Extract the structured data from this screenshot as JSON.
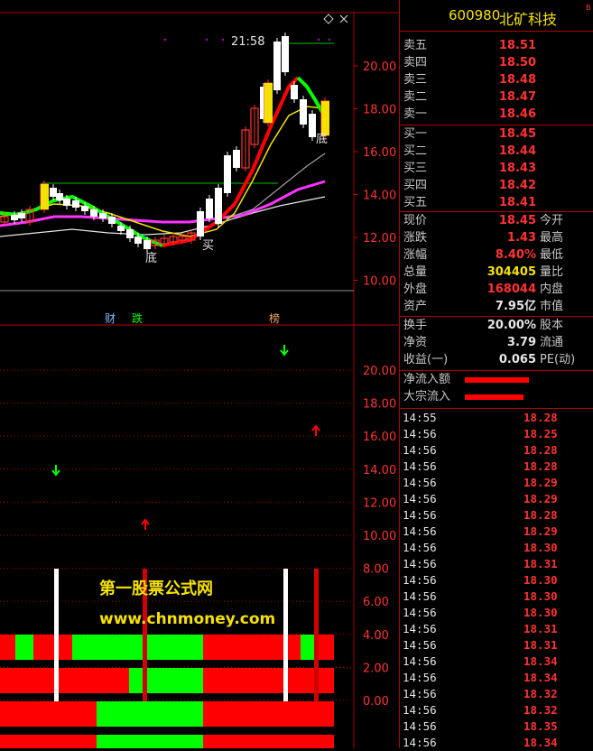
{
  "stock": {
    "code": "600980",
    "name": "北矿科技",
    "marker": "B"
  },
  "order_book": {
    "sell": [
      {
        "label": "卖五",
        "price": "18.51"
      },
      {
        "label": "卖四",
        "price": "18.50"
      },
      {
        "label": "卖三",
        "price": "18.48"
      },
      {
        "label": "卖二",
        "price": "18.47"
      },
      {
        "label": "卖一",
        "price": "18.46"
      }
    ],
    "buy": [
      {
        "label": "买一",
        "price": "18.45"
      },
      {
        "label": "买二",
        "price": "18.44"
      },
      {
        "label": "买三",
        "price": "18.43"
      },
      {
        "label": "买四",
        "price": "18.42"
      },
      {
        "label": "买五",
        "price": "18.41"
      }
    ]
  },
  "quote": [
    {
      "l1": "现价",
      "v1": "18.45",
      "l2": "今开",
      "color": "red"
    },
    {
      "l1": "涨跌",
      "v1": "1.43",
      "l2": "最高",
      "color": "red"
    },
    {
      "l1": "涨幅",
      "v1": "8.40%",
      "l2": "最低",
      "color": "red"
    },
    {
      "l1": "总量",
      "v1": "304405",
      "l2": "量比",
      "color": "yellow"
    },
    {
      "l1": "外盘",
      "v1": "168044",
      "l2": "内盘",
      "color": "red"
    },
    {
      "l1": "资产",
      "v1": "7.95亿",
      "l2": "市值",
      "color": "white"
    }
  ],
  "stats": [
    {
      "l1": "换手",
      "v1": "20.00%",
      "l2": "股本"
    },
    {
      "l1": "净资",
      "v1": "3.79",
      "l2": "流通"
    },
    {
      "l1": "收益(一)",
      "v1": "0.065",
      "l2": "PE(动)"
    }
  ],
  "flows": [
    {
      "label": "净流入额",
      "bar": 0.47
    },
    {
      "label": "大宗流入",
      "bar": 0.43
    }
  ],
  "ticks": [
    {
      "time": "14:55",
      "price": "18.28"
    },
    {
      "time": "14:56",
      "price": "18.25"
    },
    {
      "time": "14:56",
      "price": "18.28"
    },
    {
      "time": "14:56",
      "price": "18.28"
    },
    {
      "time": "14:56",
      "price": "18.29"
    },
    {
      "time": "14:56",
      "price": "18.29"
    },
    {
      "time": "14:56",
      "price": "18.28"
    },
    {
      "time": "14:56",
      "price": "18.29"
    },
    {
      "time": "14:56",
      "price": "18.30"
    },
    {
      "time": "14:56",
      "price": "18.31"
    },
    {
      "time": "14:56",
      "price": "18.30"
    },
    {
      "time": "14:56",
      "price": "18.30"
    },
    {
      "time": "14:56",
      "price": "18.30"
    },
    {
      "time": "14:56",
      "price": "18.31"
    },
    {
      "time": "14:56",
      "price": "18.31"
    },
    {
      "time": "14:56",
      "price": "18.34"
    },
    {
      "time": "14:56",
      "price": "18.34"
    },
    {
      "time": "14:56",
      "price": "18.32"
    },
    {
      "time": "14:56",
      "price": "18.32"
    },
    {
      "time": "14:56",
      "price": "18.35"
    },
    {
      "time": "14:56",
      "price": "18.34"
    }
  ],
  "chart": {
    "top_axis": [
      "20.00",
      "18.00",
      "16.00",
      "14.00",
      "12.00",
      "10.00"
    ],
    "bottom_axis": [
      "20.00",
      "18.00",
      "16.00",
      "14.00",
      "12.00",
      "10.00",
      "8.00",
      "6.00",
      "4.00",
      "2.00",
      "0.00"
    ],
    "time_label": "21:58",
    "labels": {
      "di1": "底",
      "mai": "买",
      "di2": "底",
      "cai": "财",
      "die": "跌",
      "bang": "榜"
    },
    "watermark1": "第一股票公式网",
    "watermark2": "www.chnmoney.com"
  },
  "colors": {
    "up": "#ff3232",
    "down": "#00ff00",
    "axis": "#b00000",
    "yellow": "#f5e100"
  }
}
